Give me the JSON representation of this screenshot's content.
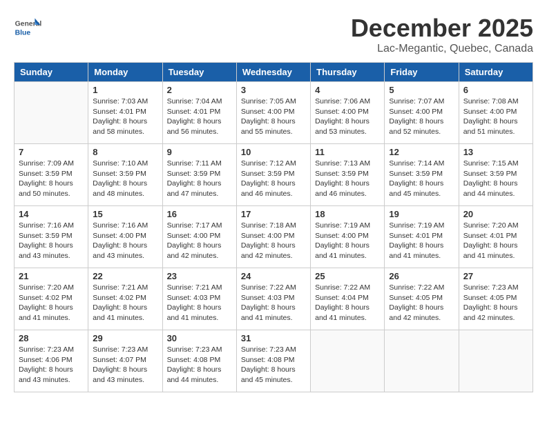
{
  "header": {
    "logo_general": "General",
    "logo_blue": "Blue",
    "month": "December 2025",
    "location": "Lac-Megantic, Quebec, Canada"
  },
  "weekdays": [
    "Sunday",
    "Monday",
    "Tuesday",
    "Wednesday",
    "Thursday",
    "Friday",
    "Saturday"
  ],
  "weeks": [
    [
      {
        "day": "",
        "sunrise": "",
        "sunset": "",
        "daylight": ""
      },
      {
        "day": "1",
        "sunrise": "Sunrise: 7:03 AM",
        "sunset": "Sunset: 4:01 PM",
        "daylight": "Daylight: 8 hours and 58 minutes."
      },
      {
        "day": "2",
        "sunrise": "Sunrise: 7:04 AM",
        "sunset": "Sunset: 4:01 PM",
        "daylight": "Daylight: 8 hours and 56 minutes."
      },
      {
        "day": "3",
        "sunrise": "Sunrise: 7:05 AM",
        "sunset": "Sunset: 4:00 PM",
        "daylight": "Daylight: 8 hours and 55 minutes."
      },
      {
        "day": "4",
        "sunrise": "Sunrise: 7:06 AM",
        "sunset": "Sunset: 4:00 PM",
        "daylight": "Daylight: 8 hours and 53 minutes."
      },
      {
        "day": "5",
        "sunrise": "Sunrise: 7:07 AM",
        "sunset": "Sunset: 4:00 PM",
        "daylight": "Daylight: 8 hours and 52 minutes."
      },
      {
        "day": "6",
        "sunrise": "Sunrise: 7:08 AM",
        "sunset": "Sunset: 4:00 PM",
        "daylight": "Daylight: 8 hours and 51 minutes."
      }
    ],
    [
      {
        "day": "7",
        "sunrise": "Sunrise: 7:09 AM",
        "sunset": "Sunset: 3:59 PM",
        "daylight": "Daylight: 8 hours and 50 minutes."
      },
      {
        "day": "8",
        "sunrise": "Sunrise: 7:10 AM",
        "sunset": "Sunset: 3:59 PM",
        "daylight": "Daylight: 8 hours and 48 minutes."
      },
      {
        "day": "9",
        "sunrise": "Sunrise: 7:11 AM",
        "sunset": "Sunset: 3:59 PM",
        "daylight": "Daylight: 8 hours and 47 minutes."
      },
      {
        "day": "10",
        "sunrise": "Sunrise: 7:12 AM",
        "sunset": "Sunset: 3:59 PM",
        "daylight": "Daylight: 8 hours and 46 minutes."
      },
      {
        "day": "11",
        "sunrise": "Sunrise: 7:13 AM",
        "sunset": "Sunset: 3:59 PM",
        "daylight": "Daylight: 8 hours and 46 minutes."
      },
      {
        "day": "12",
        "sunrise": "Sunrise: 7:14 AM",
        "sunset": "Sunset: 3:59 PM",
        "daylight": "Daylight: 8 hours and 45 minutes."
      },
      {
        "day": "13",
        "sunrise": "Sunrise: 7:15 AM",
        "sunset": "Sunset: 3:59 PM",
        "daylight": "Daylight: 8 hours and 44 minutes."
      }
    ],
    [
      {
        "day": "14",
        "sunrise": "Sunrise: 7:16 AM",
        "sunset": "Sunset: 3:59 PM",
        "daylight": "Daylight: 8 hours and 43 minutes."
      },
      {
        "day": "15",
        "sunrise": "Sunrise: 7:16 AM",
        "sunset": "Sunset: 4:00 PM",
        "daylight": "Daylight: 8 hours and 43 minutes."
      },
      {
        "day": "16",
        "sunrise": "Sunrise: 7:17 AM",
        "sunset": "Sunset: 4:00 PM",
        "daylight": "Daylight: 8 hours and 42 minutes."
      },
      {
        "day": "17",
        "sunrise": "Sunrise: 7:18 AM",
        "sunset": "Sunset: 4:00 PM",
        "daylight": "Daylight: 8 hours and 42 minutes."
      },
      {
        "day": "18",
        "sunrise": "Sunrise: 7:19 AM",
        "sunset": "Sunset: 4:00 PM",
        "daylight": "Daylight: 8 hours and 41 minutes."
      },
      {
        "day": "19",
        "sunrise": "Sunrise: 7:19 AM",
        "sunset": "Sunset: 4:01 PM",
        "daylight": "Daylight: 8 hours and 41 minutes."
      },
      {
        "day": "20",
        "sunrise": "Sunrise: 7:20 AM",
        "sunset": "Sunset: 4:01 PM",
        "daylight": "Daylight: 8 hours and 41 minutes."
      }
    ],
    [
      {
        "day": "21",
        "sunrise": "Sunrise: 7:20 AM",
        "sunset": "Sunset: 4:02 PM",
        "daylight": "Daylight: 8 hours and 41 minutes."
      },
      {
        "day": "22",
        "sunrise": "Sunrise: 7:21 AM",
        "sunset": "Sunset: 4:02 PM",
        "daylight": "Daylight: 8 hours and 41 minutes."
      },
      {
        "day": "23",
        "sunrise": "Sunrise: 7:21 AM",
        "sunset": "Sunset: 4:03 PM",
        "daylight": "Daylight: 8 hours and 41 minutes."
      },
      {
        "day": "24",
        "sunrise": "Sunrise: 7:22 AM",
        "sunset": "Sunset: 4:03 PM",
        "daylight": "Daylight: 8 hours and 41 minutes."
      },
      {
        "day": "25",
        "sunrise": "Sunrise: 7:22 AM",
        "sunset": "Sunset: 4:04 PM",
        "daylight": "Daylight: 8 hours and 41 minutes."
      },
      {
        "day": "26",
        "sunrise": "Sunrise: 7:22 AM",
        "sunset": "Sunset: 4:05 PM",
        "daylight": "Daylight: 8 hours and 42 minutes."
      },
      {
        "day": "27",
        "sunrise": "Sunrise: 7:23 AM",
        "sunset": "Sunset: 4:05 PM",
        "daylight": "Daylight: 8 hours and 42 minutes."
      }
    ],
    [
      {
        "day": "28",
        "sunrise": "Sunrise: 7:23 AM",
        "sunset": "Sunset: 4:06 PM",
        "daylight": "Daylight: 8 hours and 43 minutes."
      },
      {
        "day": "29",
        "sunrise": "Sunrise: 7:23 AM",
        "sunset": "Sunset: 4:07 PM",
        "daylight": "Daylight: 8 hours and 43 minutes."
      },
      {
        "day": "30",
        "sunrise": "Sunrise: 7:23 AM",
        "sunset": "Sunset: 4:08 PM",
        "daylight": "Daylight: 8 hours and 44 minutes."
      },
      {
        "day": "31",
        "sunrise": "Sunrise: 7:23 AM",
        "sunset": "Sunset: 4:08 PM",
        "daylight": "Daylight: 8 hours and 45 minutes."
      },
      {
        "day": "",
        "sunrise": "",
        "sunset": "",
        "daylight": ""
      },
      {
        "day": "",
        "sunrise": "",
        "sunset": "",
        "daylight": ""
      },
      {
        "day": "",
        "sunrise": "",
        "sunset": "",
        "daylight": ""
      }
    ]
  ]
}
